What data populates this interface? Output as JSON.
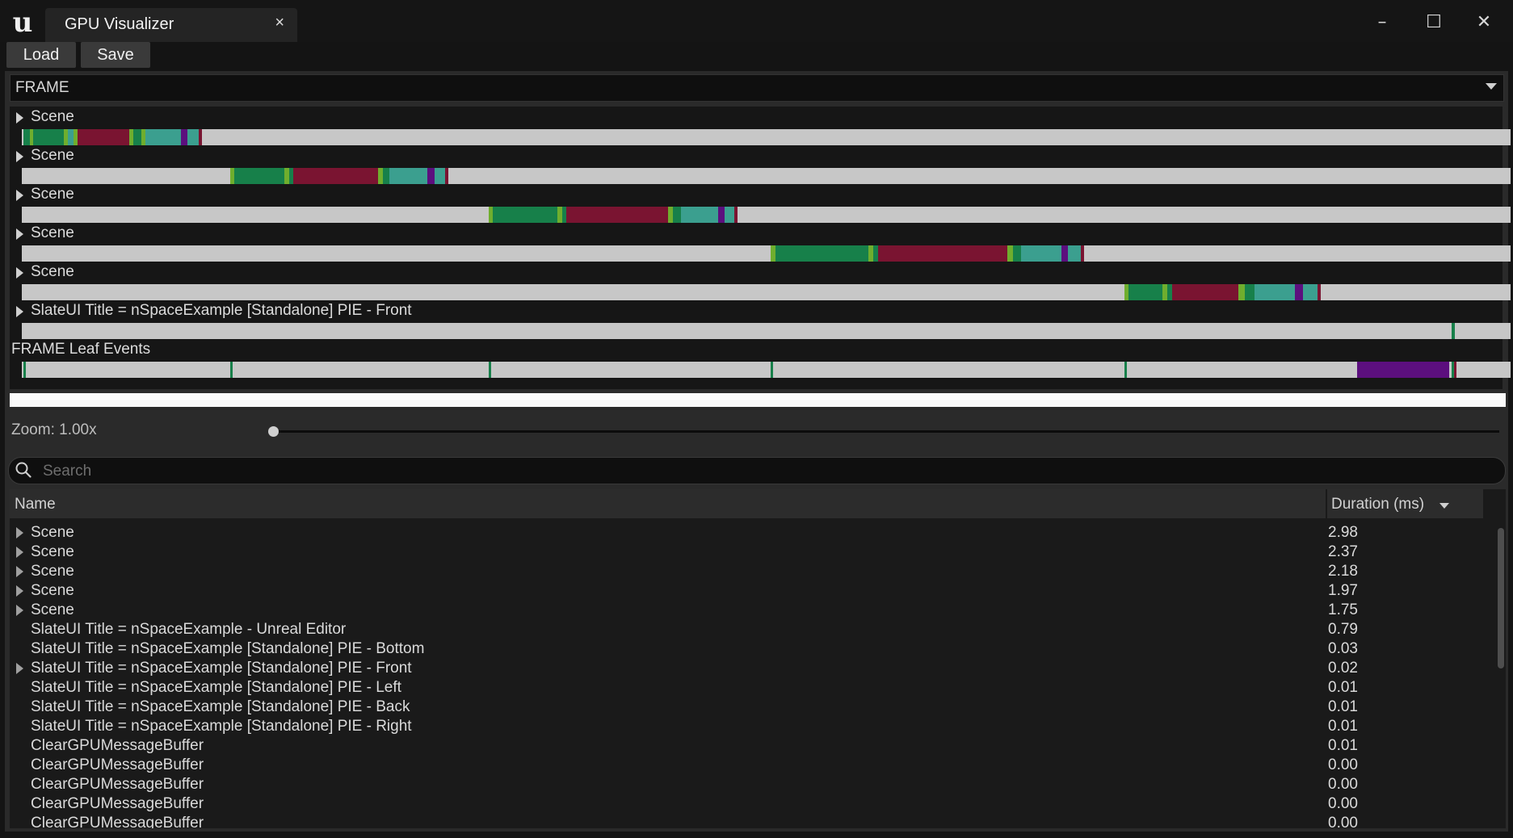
{
  "window": {
    "tab_title": "GPU Visualizer",
    "tab_close_glyph": "×",
    "controls": {
      "minimize": "–",
      "maximize": "☐",
      "close": "✕"
    }
  },
  "app_logo": {
    "text": "u",
    "icon": "unreal-logo-icon"
  },
  "toolbar": {
    "load_label": "Load",
    "save_label": "Save"
  },
  "frame_selector": {
    "value": "FRAME"
  },
  "timeline": {
    "tracks": [
      {
        "label": "Scene"
      },
      {
        "label": "Scene"
      },
      {
        "label": "Scene"
      },
      {
        "label": "Scene"
      },
      {
        "label": "Scene"
      },
      {
        "label": "SlateUI Title = nSpaceExample [Standalone] PIE - Front"
      }
    ],
    "leaf_label": "FRAME Leaf Events",
    "colors": {
      "green": "#17804a",
      "crimson": "#7a1431",
      "teal": "#3b9f8f",
      "lime": "#6fae2e",
      "purple": "#5c0f7e",
      "bar_bg": "#c7c7c7"
    }
  },
  "zoom": {
    "label": "Zoom: 1.00x",
    "value": 1.0
  },
  "search": {
    "placeholder": "Search",
    "value": ""
  },
  "table": {
    "columns": {
      "name": "Name",
      "duration": "Duration (ms)"
    },
    "rows": [
      {
        "name": "Scene",
        "duration": "2.98",
        "expandable": true
      },
      {
        "name": "Scene",
        "duration": "2.37",
        "expandable": true
      },
      {
        "name": "Scene",
        "duration": "2.18",
        "expandable": true
      },
      {
        "name": "Scene",
        "duration": "1.97",
        "expandable": true
      },
      {
        "name": "Scene",
        "duration": "1.75",
        "expandable": true
      },
      {
        "name": "SlateUI Title = nSpaceExample - Unreal Editor",
        "duration": "0.79",
        "expandable": false
      },
      {
        "name": "SlateUI Title = nSpaceExample [Standalone] PIE - Bottom",
        "duration": "0.03",
        "expandable": false
      },
      {
        "name": "SlateUI Title = nSpaceExample [Standalone] PIE - Front",
        "duration": "0.02",
        "expandable": true
      },
      {
        "name": "SlateUI Title = nSpaceExample [Standalone] PIE - Left",
        "duration": "0.01",
        "expandable": false
      },
      {
        "name": "SlateUI Title = nSpaceExample [Standalone] PIE - Back",
        "duration": "0.01",
        "expandable": false
      },
      {
        "name": "SlateUI Title = nSpaceExample [Standalone] PIE - Right",
        "duration": "0.01",
        "expandable": false
      },
      {
        "name": "ClearGPUMessageBuffer",
        "duration": "0.01",
        "expandable": false
      },
      {
        "name": "ClearGPUMessageBuffer",
        "duration": "0.00",
        "expandable": false
      },
      {
        "name": "ClearGPUMessageBuffer",
        "duration": "0.00",
        "expandable": false
      },
      {
        "name": "ClearGPUMessageBuffer",
        "duration": "0.00",
        "expandable": false
      },
      {
        "name": "ClearGPUMessageBuffer",
        "duration": "0.00",
        "expandable": false
      }
    ]
  }
}
